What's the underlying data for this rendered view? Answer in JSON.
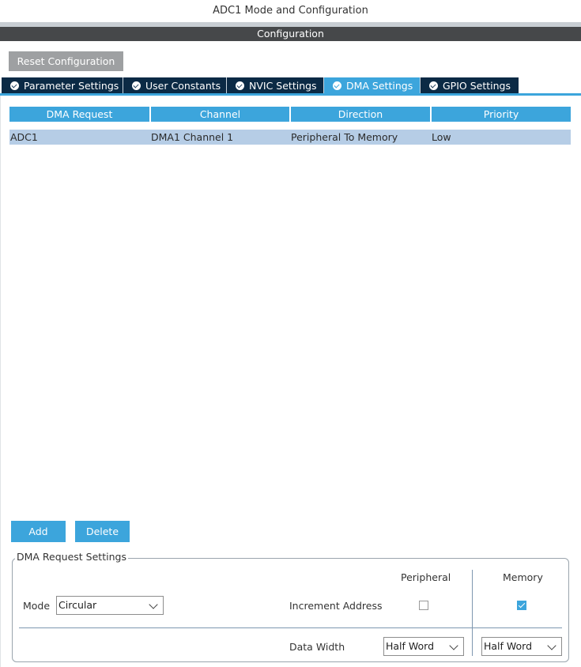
{
  "window": {
    "title": "ADC1 Mode and Configuration",
    "section": "Configuration"
  },
  "toolbar": {
    "reset_label": "Reset Configuration"
  },
  "tabs": [
    {
      "label": "Parameter Settings",
      "icon": "check-circle-icon",
      "active": false
    },
    {
      "label": "User Constants",
      "icon": "check-circle-icon",
      "active": false
    },
    {
      "label": "NVIC Settings",
      "icon": "check-circle-icon",
      "active": false
    },
    {
      "label": "DMA Settings",
      "icon": "check-circle-icon",
      "active": true
    },
    {
      "label": "GPIO Settings",
      "icon": "check-circle-icon",
      "active": false
    }
  ],
  "table": {
    "columns": [
      "DMA Request",
      "Channel",
      "Direction",
      "Priority"
    ],
    "rows": [
      [
        "ADC1",
        "DMA1 Channel 1",
        "Peripheral To Memory",
        "Low"
      ]
    ]
  },
  "actions": {
    "add_label": "Add",
    "delete_label": "Delete"
  },
  "settings": {
    "group_title": "DMA Request Settings",
    "mode_label": "Mode",
    "mode_value": "Circular",
    "col_peripheral": "Peripheral",
    "col_memory": "Memory",
    "increment_label": "Increment Address",
    "increment_peripheral": false,
    "increment_memory": true,
    "data_width_label": "Data Width",
    "data_width_peripheral": "Half Word",
    "data_width_memory": "Half Word"
  },
  "colors": {
    "accent": "#3ca5dc",
    "tab_inactive": "#0b2a45",
    "selected_row": "#b6cde6",
    "config_bar": "#46484a",
    "reset_button": "#9ea0a2"
  }
}
